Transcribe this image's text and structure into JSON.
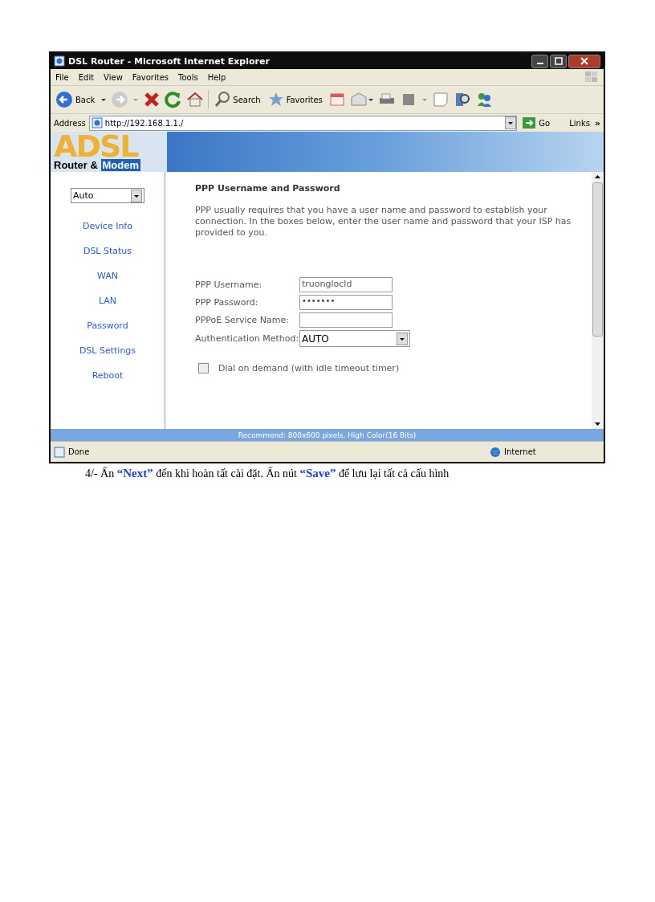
{
  "window": {
    "title": "DSL Router - Microsoft Internet Explorer"
  },
  "menu": [
    "File",
    "Edit",
    "View",
    "Favorites",
    "Tools",
    "Help"
  ],
  "toolbar": {
    "back": "Back",
    "search": "Search",
    "favorites": "Favorites"
  },
  "address": {
    "label": "Address",
    "url": "http://192.168.1.1./",
    "go": "Go",
    "links": "Links",
    "more": "»"
  },
  "logo": {
    "letters": "ADSL",
    "line_1": "Router &",
    "line_2": "Modem"
  },
  "sidebar": {
    "language": "Auto",
    "items": [
      "Device Info",
      "DSL Status",
      "WAN",
      "LAN",
      "Password",
      "DSL Settings",
      "Reboot"
    ]
  },
  "form": {
    "title": "PPP Username and Password",
    "intro": "PPP usually requires that you have a user name and password to establish your connection. In the boxes below, enter the user name and password that your ISP has provided to you.",
    "fields": [
      {
        "kind": "text",
        "label": "PPP Username:",
        "value": "truonglocld"
      },
      {
        "kind": "password",
        "label": "PPP Password:",
        "value": "•••••••"
      },
      {
        "kind": "text",
        "label": "PPPoE Service Name:"
      },
      {
        "kind": "select",
        "label": "Authentication Method:",
        "value": "AUTO"
      }
    ],
    "dial_on_demand": {
      "label": "Dial on demand (with idle timeout timer)",
      "checked": false
    }
  },
  "recommend": "Recommend: 800x600 pixels, High Color(16 Bits)",
  "status_bar": {
    "status": "Done",
    "zone": "Internet"
  },
  "caption": "4/- Ấn **“Next”** đến khi hoàn tất cài đặt. Ấn nút **“Save”** để lưu lại tất cả cấu hình"
}
